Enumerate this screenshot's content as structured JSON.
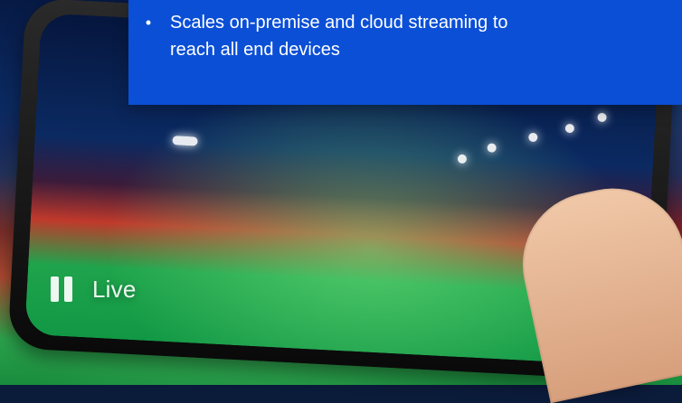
{
  "overlay": {
    "bullet_symbol": "•",
    "lines": [
      "Scales on-premise and cloud streaming to",
      "reach all end devices"
    ]
  },
  "player": {
    "pause_icon": "pause-icon",
    "live_label": "Live"
  },
  "colors": {
    "overlay_blue": "#0B4FD6"
  }
}
